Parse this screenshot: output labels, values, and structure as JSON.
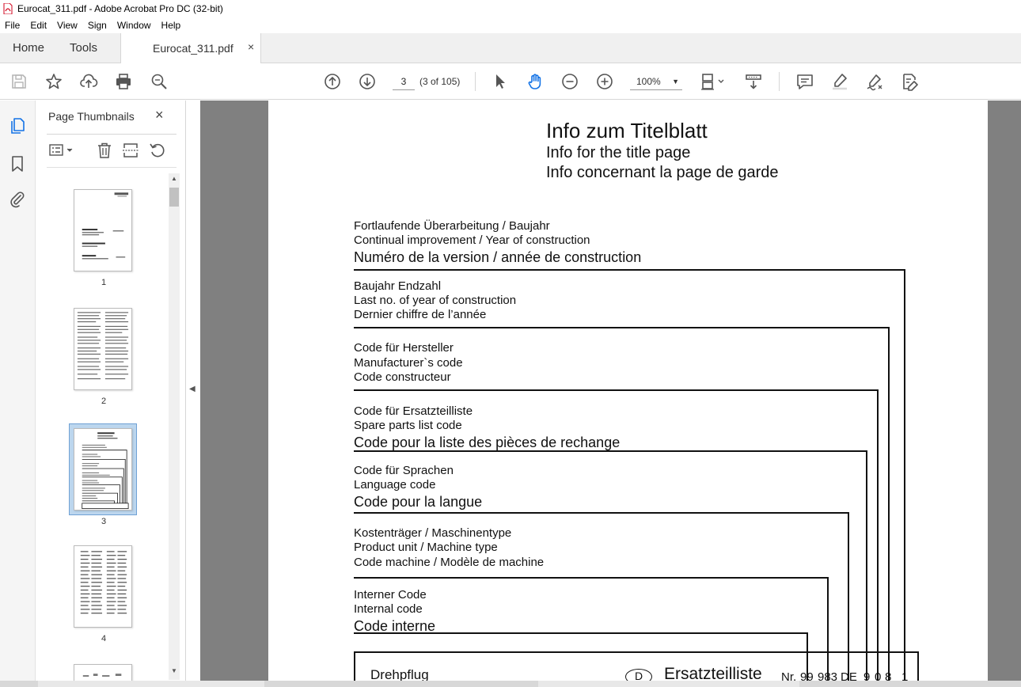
{
  "window": {
    "title": "Eurocat_311.pdf - Adobe Acrobat Pro DC (32-bit)"
  },
  "menu": [
    "File",
    "Edit",
    "View",
    "Sign",
    "Window",
    "Help"
  ],
  "tabs": {
    "home": "Home",
    "tools": "Tools",
    "document": "Eurocat_311.pdf",
    "close": "×"
  },
  "toolbar": {
    "page_current": "3",
    "page_count": "(3 of 105)",
    "zoom": "100%",
    "icons": [
      "save-icon",
      "star-icon",
      "upload-icon",
      "print-icon",
      "zoom-search-icon",
      "page-up-icon",
      "page-down-icon",
      "select-pointer-icon",
      "hand-tool-icon",
      "zoom-out-icon",
      "zoom-in-icon",
      "page-fit-icon",
      "scroll-mode-icon",
      "comment-icon",
      "highlight-icon",
      "sign-icon",
      "fill-sign-icon"
    ]
  },
  "sidebar": {
    "pane_title": "Page Thumbnails",
    "close": "×",
    "thumbnails": [
      {
        "label": "1"
      },
      {
        "label": "2"
      },
      {
        "label": "3",
        "selected": true
      },
      {
        "label": "4"
      }
    ]
  },
  "document": {
    "heading_de": "Info  zum  Titelblatt",
    "heading_en": "Info for the title page",
    "heading_fr": "Info concernant la page de garde",
    "blocks": [
      {
        "lines": [
          "Fortlaufende Überarbeitung / Baujahr",
          "Continual improvement / Year of construction",
          "Numéro de la version / année de construction"
        ]
      },
      {
        "lines": [
          "Baujahr Endzahl",
          "Last no. of year of construction",
          "Dernier chiffre de l’année"
        ]
      },
      {
        "lines": [
          "Code für Hersteller",
          "Manufacturer`s  code",
          "Code constructeur"
        ]
      },
      {
        "lines": [
          "Code für Ersatzteilliste",
          "Spare parts list code",
          "Code pour la liste des pièces de rechange"
        ]
      },
      {
        "lines": [
          "Code für Sprachen",
          "Language code",
          "Code pour la langue"
        ]
      },
      {
        "lines": [
          "Kostenträger / Maschinentype",
          "Product unit / Machine type",
          "Code machine / Modèle de machine"
        ]
      },
      {
        "lines": [
          "Interner Code",
          "Internal code",
          "Code interne"
        ]
      }
    ],
    "box": {
      "left_text": "Drehpflug",
      "circle_text": "D",
      "center_text": "Ersatzteilliste",
      "code": [
        "Nr.",
        "99",
        "983",
        "DE",
        "9",
        "0",
        "8",
        "1"
      ]
    }
  }
}
